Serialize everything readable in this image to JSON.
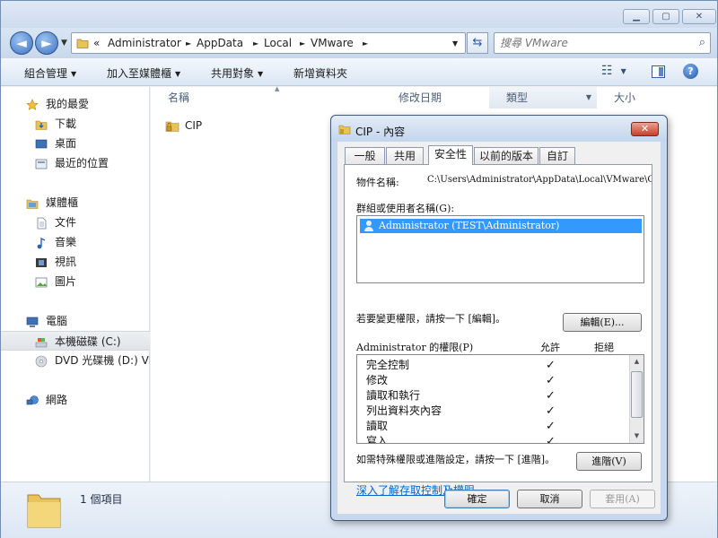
{
  "window": {
    "buttons": {
      "minimize": "▁",
      "maximize": "▢",
      "close": "✕"
    }
  },
  "address": {
    "back": "◄",
    "forward": "►",
    "dropdown": "▼",
    "chevron": "«",
    "crumbs": [
      "Administrator",
      "AppData",
      "Local",
      "VMware"
    ],
    "separator": "►",
    "end_dropdown": "▼",
    "refresh": "⇆"
  },
  "search": {
    "placeholder": "搜尋 VMware",
    "icon": "⌕"
  },
  "toolbar": {
    "organize": "組合管理",
    "add_to_library": "加入至媒體櫃",
    "share_with": "共用對象",
    "new_folder": "新增資料夾",
    "dropdown": "▼",
    "view_icon": "☷",
    "help": "?"
  },
  "sidebar": {
    "favorites": {
      "label": "我的最愛",
      "items": [
        "下載",
        "桌面",
        "最近的位置"
      ]
    },
    "libraries": {
      "label": "媒體櫃",
      "items": [
        "文件",
        "音樂",
        "視訊",
        "圖片"
      ]
    },
    "computer": {
      "label": "電腦",
      "items": [
        "本機磁碟 (C:)",
        "DVD 光碟機 (D:) VMware"
      ]
    },
    "network": {
      "label": "網路"
    }
  },
  "columns": {
    "name": "名稱",
    "date": "修改日期",
    "type": "類型",
    "size": "大小"
  },
  "files": [
    {
      "name": "CIP"
    }
  ],
  "details": {
    "count": "1 個項目"
  },
  "dialog": {
    "title": "CIP - 內容",
    "close": "✕",
    "tabs": [
      "一般",
      "共用",
      "安全性",
      "以前的版本",
      "自訂"
    ],
    "object_label": "物件名稱:",
    "object_value": "C:\\Users\\Administrator\\AppData\\Local\\VMware\\CIP",
    "groups_label": "群組或使用者名稱(G):",
    "groups": [
      "Administrator (TEST\\Administrator)"
    ],
    "change_hint": "若要變更權限，請按一下 [編輯]。",
    "edit_button": "編輯(E)...",
    "perm_header": "Administrator 的權限(P)",
    "allow": "允許",
    "deny": "拒絕",
    "permissions": [
      {
        "name": "完全控制",
        "allow": "✓"
      },
      {
        "name": "修改",
        "allow": "✓"
      },
      {
        "name": "讀取和執行",
        "allow": "✓"
      },
      {
        "name": "列出資料夾內容",
        "allow": "✓"
      },
      {
        "name": "讀取",
        "allow": "✓"
      },
      {
        "name": "寫入",
        "allow": "✓"
      }
    ],
    "advanced_hint": "如需特殊權限或進階設定，請按一下 [進階]。",
    "advanced_button": "進階(V)",
    "learn_link": "深入了解存取控制及權限",
    "ok": "確定",
    "cancel": "取消",
    "apply": "套用(A)"
  }
}
